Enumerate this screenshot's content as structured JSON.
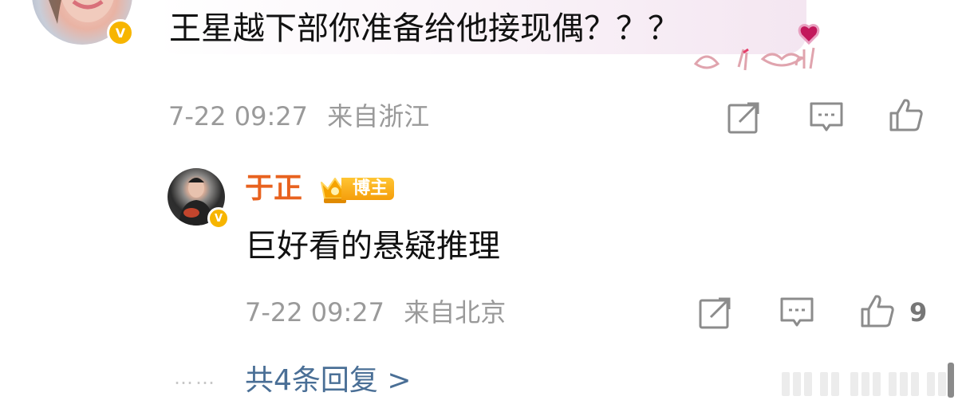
{
  "top_comment": {
    "text": "王星越下部你准备给他接现偶？？？",
    "timestamp": "7-22 09:27",
    "location": "来自浙江",
    "verified_badge": "V",
    "decoration": "heart-gestures"
  },
  "reply": {
    "username": "于正",
    "badge_label": "博主",
    "text": "巨好看的悬疑推理",
    "timestamp": "7-22 09:27",
    "location": "来自北京",
    "like_count": "9",
    "verified_badge": "V"
  },
  "more_replies": {
    "dots": "……",
    "label": "共4条回复 >"
  },
  "colors": {
    "name_orange": "#e8621f",
    "link_blue": "#4a6f96",
    "meta_gray": "#9a9a9a",
    "badge_gold": "#f7b500"
  },
  "icons": [
    "share-icon",
    "comment-icon",
    "like-icon"
  ]
}
